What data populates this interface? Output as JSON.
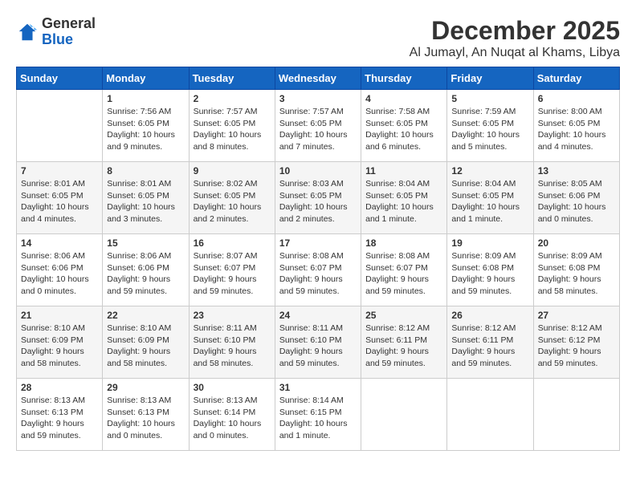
{
  "header": {
    "logo_general": "General",
    "logo_blue": "Blue",
    "month": "December 2025",
    "location": "Al Jumayl, An Nuqat al Khams, Libya"
  },
  "weekdays": [
    "Sunday",
    "Monday",
    "Tuesday",
    "Wednesday",
    "Thursday",
    "Friday",
    "Saturday"
  ],
  "weeks": [
    [
      {
        "day": "",
        "sunrise": "",
        "sunset": "",
        "daylight": ""
      },
      {
        "day": "1",
        "sunrise": "Sunrise: 7:56 AM",
        "sunset": "Sunset: 6:05 PM",
        "daylight": "Daylight: 10 hours and 9 minutes."
      },
      {
        "day": "2",
        "sunrise": "Sunrise: 7:57 AM",
        "sunset": "Sunset: 6:05 PM",
        "daylight": "Daylight: 10 hours and 8 minutes."
      },
      {
        "day": "3",
        "sunrise": "Sunrise: 7:57 AM",
        "sunset": "Sunset: 6:05 PM",
        "daylight": "Daylight: 10 hours and 7 minutes."
      },
      {
        "day": "4",
        "sunrise": "Sunrise: 7:58 AM",
        "sunset": "Sunset: 6:05 PM",
        "daylight": "Daylight: 10 hours and 6 minutes."
      },
      {
        "day": "5",
        "sunrise": "Sunrise: 7:59 AM",
        "sunset": "Sunset: 6:05 PM",
        "daylight": "Daylight: 10 hours and 5 minutes."
      },
      {
        "day": "6",
        "sunrise": "Sunrise: 8:00 AM",
        "sunset": "Sunset: 6:05 PM",
        "daylight": "Daylight: 10 hours and 4 minutes."
      }
    ],
    [
      {
        "day": "7",
        "sunrise": "Sunrise: 8:01 AM",
        "sunset": "Sunset: 6:05 PM",
        "daylight": "Daylight: 10 hours and 4 minutes."
      },
      {
        "day": "8",
        "sunrise": "Sunrise: 8:01 AM",
        "sunset": "Sunset: 6:05 PM",
        "daylight": "Daylight: 10 hours and 3 minutes."
      },
      {
        "day": "9",
        "sunrise": "Sunrise: 8:02 AM",
        "sunset": "Sunset: 6:05 PM",
        "daylight": "Daylight: 10 hours and 2 minutes."
      },
      {
        "day": "10",
        "sunrise": "Sunrise: 8:03 AM",
        "sunset": "Sunset: 6:05 PM",
        "daylight": "Daylight: 10 hours and 2 minutes."
      },
      {
        "day": "11",
        "sunrise": "Sunrise: 8:04 AM",
        "sunset": "Sunset: 6:05 PM",
        "daylight": "Daylight: 10 hours and 1 minute."
      },
      {
        "day": "12",
        "sunrise": "Sunrise: 8:04 AM",
        "sunset": "Sunset: 6:05 PM",
        "daylight": "Daylight: 10 hours and 1 minute."
      },
      {
        "day": "13",
        "sunrise": "Sunrise: 8:05 AM",
        "sunset": "Sunset: 6:06 PM",
        "daylight": "Daylight: 10 hours and 0 minutes."
      }
    ],
    [
      {
        "day": "14",
        "sunrise": "Sunrise: 8:06 AM",
        "sunset": "Sunset: 6:06 PM",
        "daylight": "Daylight: 10 hours and 0 minutes."
      },
      {
        "day": "15",
        "sunrise": "Sunrise: 8:06 AM",
        "sunset": "Sunset: 6:06 PM",
        "daylight": "Daylight: 9 hours and 59 minutes."
      },
      {
        "day": "16",
        "sunrise": "Sunrise: 8:07 AM",
        "sunset": "Sunset: 6:07 PM",
        "daylight": "Daylight: 9 hours and 59 minutes."
      },
      {
        "day": "17",
        "sunrise": "Sunrise: 8:08 AM",
        "sunset": "Sunset: 6:07 PM",
        "daylight": "Daylight: 9 hours and 59 minutes."
      },
      {
        "day": "18",
        "sunrise": "Sunrise: 8:08 AM",
        "sunset": "Sunset: 6:07 PM",
        "daylight": "Daylight: 9 hours and 59 minutes."
      },
      {
        "day": "19",
        "sunrise": "Sunrise: 8:09 AM",
        "sunset": "Sunset: 6:08 PM",
        "daylight": "Daylight: 9 hours and 59 minutes."
      },
      {
        "day": "20",
        "sunrise": "Sunrise: 8:09 AM",
        "sunset": "Sunset: 6:08 PM",
        "daylight": "Daylight: 9 hours and 58 minutes."
      }
    ],
    [
      {
        "day": "21",
        "sunrise": "Sunrise: 8:10 AM",
        "sunset": "Sunset: 6:09 PM",
        "daylight": "Daylight: 9 hours and 58 minutes."
      },
      {
        "day": "22",
        "sunrise": "Sunrise: 8:10 AM",
        "sunset": "Sunset: 6:09 PM",
        "daylight": "Daylight: 9 hours and 58 minutes."
      },
      {
        "day": "23",
        "sunrise": "Sunrise: 8:11 AM",
        "sunset": "Sunset: 6:10 PM",
        "daylight": "Daylight: 9 hours and 58 minutes."
      },
      {
        "day": "24",
        "sunrise": "Sunrise: 8:11 AM",
        "sunset": "Sunset: 6:10 PM",
        "daylight": "Daylight: 9 hours and 59 minutes."
      },
      {
        "day": "25",
        "sunrise": "Sunrise: 8:12 AM",
        "sunset": "Sunset: 6:11 PM",
        "daylight": "Daylight: 9 hours and 59 minutes."
      },
      {
        "day": "26",
        "sunrise": "Sunrise: 8:12 AM",
        "sunset": "Sunset: 6:11 PM",
        "daylight": "Daylight: 9 hours and 59 minutes."
      },
      {
        "day": "27",
        "sunrise": "Sunrise: 8:12 AM",
        "sunset": "Sunset: 6:12 PM",
        "daylight": "Daylight: 9 hours and 59 minutes."
      }
    ],
    [
      {
        "day": "28",
        "sunrise": "Sunrise: 8:13 AM",
        "sunset": "Sunset: 6:13 PM",
        "daylight": "Daylight: 9 hours and 59 minutes."
      },
      {
        "day": "29",
        "sunrise": "Sunrise: 8:13 AM",
        "sunset": "Sunset: 6:13 PM",
        "daylight": "Daylight: 10 hours and 0 minutes."
      },
      {
        "day": "30",
        "sunrise": "Sunrise: 8:13 AM",
        "sunset": "Sunset: 6:14 PM",
        "daylight": "Daylight: 10 hours and 0 minutes."
      },
      {
        "day": "31",
        "sunrise": "Sunrise: 8:14 AM",
        "sunset": "Sunset: 6:15 PM",
        "daylight": "Daylight: 10 hours and 1 minute."
      },
      {
        "day": "",
        "sunrise": "",
        "sunset": "",
        "daylight": ""
      },
      {
        "day": "",
        "sunrise": "",
        "sunset": "",
        "daylight": ""
      },
      {
        "day": "",
        "sunrise": "",
        "sunset": "",
        "daylight": ""
      }
    ]
  ]
}
